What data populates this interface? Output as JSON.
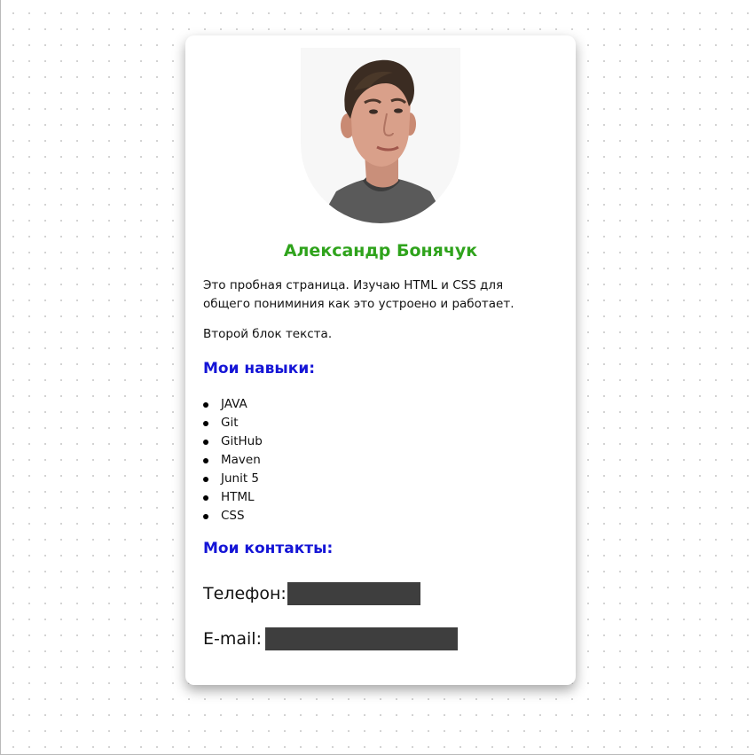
{
  "profile": {
    "name": "Александр Бонячук",
    "avatar_alt": "",
    "name_color": "#2fa31c"
  },
  "about": {
    "paragraph1": "Это пробная страница. Изучаю HTML и CSS для общего пониминия как это устроено и работает.",
    "paragraph2": "Второй блок текста."
  },
  "skills": {
    "heading": "Мои навыки:",
    "items": [
      "JAVA",
      "Git",
      "GitHub",
      "Maven",
      "Junit 5",
      "HTML",
      "CSS"
    ]
  },
  "contacts": {
    "heading": "Мои контакты:",
    "phone_label": "Телефон:",
    "email_label": "E-mail:"
  },
  "colors": {
    "heading": "#1515d6",
    "redaction": "#3e3e3e"
  }
}
